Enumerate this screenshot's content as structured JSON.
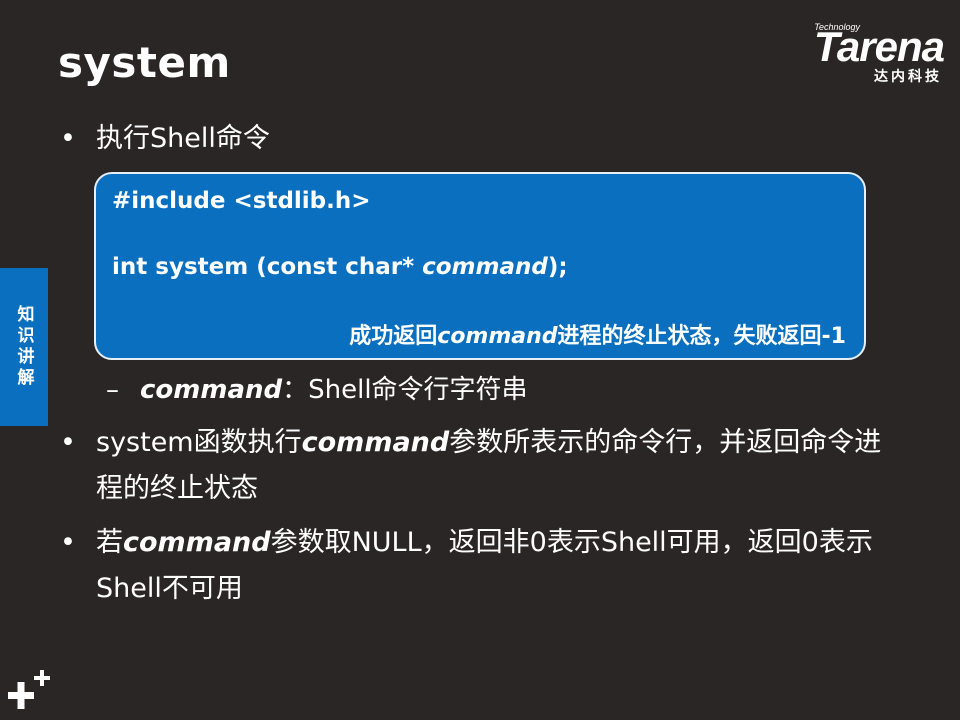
{
  "slide": {
    "title": "system",
    "logo": {
      "small": "Technology",
      "word": "Tarena",
      "sub": "达内科技"
    },
    "side_tab": "知识讲解"
  },
  "bullets": [
    {
      "text": "执行Shell命令"
    },
    {
      "pre": "system函数执行",
      "emph": "command",
      "post": "参数所表示的命令行，并返回命令进程的终止状态"
    },
    {
      "pre": "若",
      "emph": "command",
      "post": "参数取NULL，返回非0表示Shell可用，返回0表示Shell不可用"
    }
  ],
  "code": {
    "line1": "#include <stdlib.h>",
    "line2_pre": "int system (const char* ",
    "line2_emph": "command",
    "line2_post": ");",
    "note_pre": "成功返回",
    "note_emph": "command",
    "note_post": "进程的终止状态，失败返回-1"
  },
  "sub_item": {
    "dash": "–",
    "emph": "command",
    "text": "：Shell命令行字符串"
  },
  "colors": {
    "background": "#2a2625",
    "accent": "#0a6fbf"
  }
}
